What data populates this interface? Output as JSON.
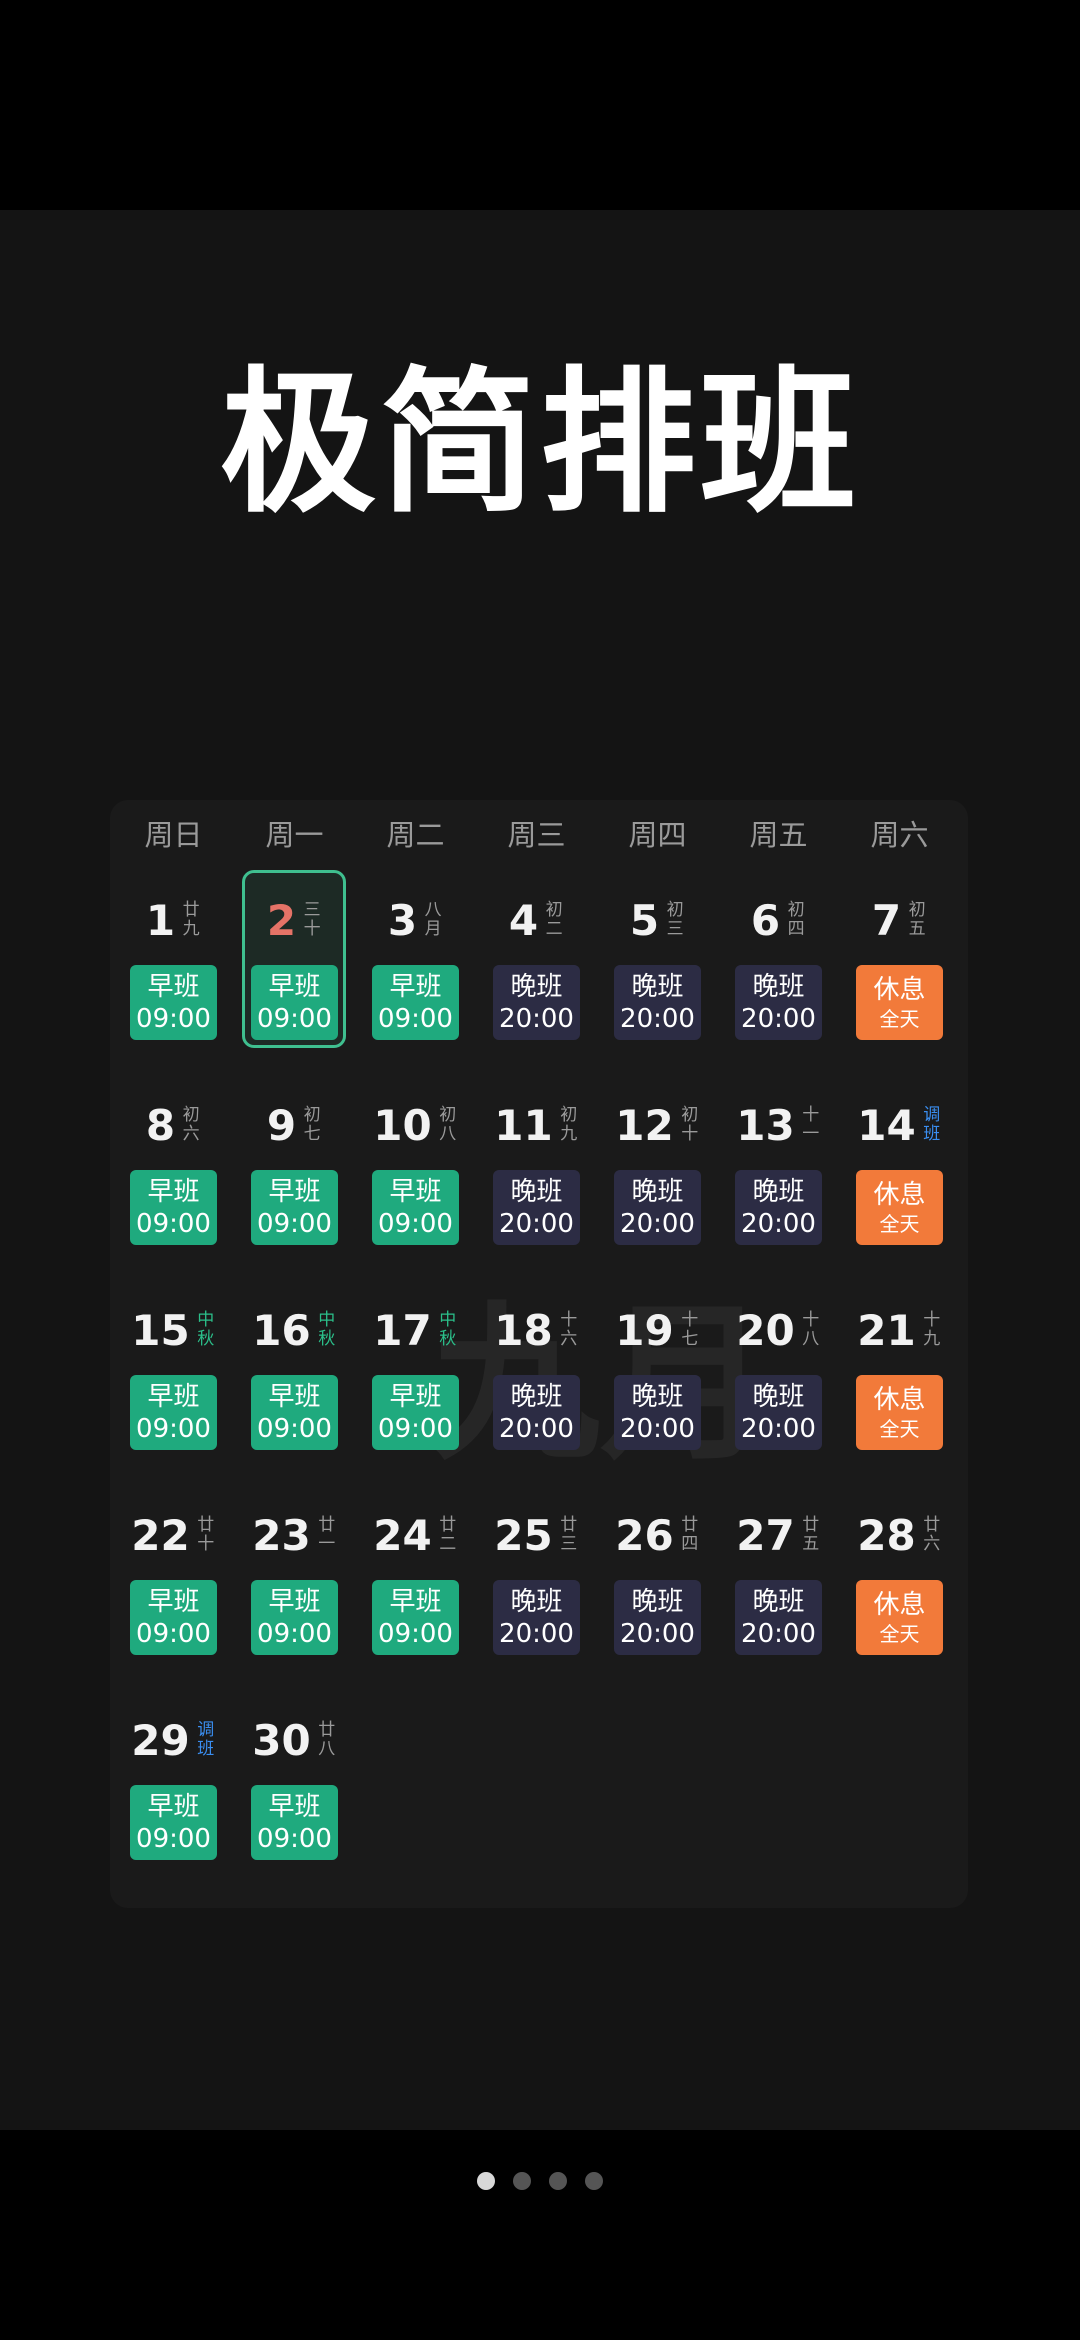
{
  "title": "极简排班",
  "watermark": "九月",
  "weekdays": [
    "周日",
    "周一",
    "周二",
    "周三",
    "周四",
    "周五",
    "周六"
  ],
  "selected_day": 2,
  "days": [
    {
      "n": "1",
      "lunar": [
        "廿",
        "九"
      ],
      "shift": "morning"
    },
    {
      "n": "2",
      "lunar": [
        "三",
        "十"
      ],
      "shift": "morning",
      "red": true
    },
    {
      "n": "3",
      "lunar": [
        "八",
        "月"
      ],
      "shift": "morning"
    },
    {
      "n": "4",
      "lunar": [
        "初",
        "二"
      ],
      "shift": "night"
    },
    {
      "n": "5",
      "lunar": [
        "初",
        "三"
      ],
      "shift": "night"
    },
    {
      "n": "6",
      "lunar": [
        "初",
        "四"
      ],
      "shift": "night"
    },
    {
      "n": "7",
      "lunar": [
        "初",
        "五"
      ],
      "shift": "rest"
    },
    {
      "n": "8",
      "lunar": [
        "初",
        "六"
      ],
      "shift": "morning"
    },
    {
      "n": "9",
      "lunar": [
        "初",
        "七"
      ],
      "shift": "morning"
    },
    {
      "n": "10",
      "lunar": [
        "初",
        "八"
      ],
      "shift": "morning"
    },
    {
      "n": "11",
      "lunar": [
        "初",
        "九"
      ],
      "shift": "night"
    },
    {
      "n": "12",
      "lunar": [
        "初",
        "十"
      ],
      "shift": "night"
    },
    {
      "n": "13",
      "lunar": [
        "十",
        "一"
      ],
      "shift": "night"
    },
    {
      "n": "14",
      "lunar": [
        "调",
        "班"
      ],
      "lunar_style": "adjust",
      "shift": "rest"
    },
    {
      "n": "15",
      "lunar": [
        "中",
        "秋"
      ],
      "lunar_style": "holiday",
      "shift": "morning"
    },
    {
      "n": "16",
      "lunar": [
        "中",
        "秋"
      ],
      "lunar_style": "holiday",
      "shift": "morning"
    },
    {
      "n": "17",
      "lunar": [
        "中",
        "秋"
      ],
      "lunar_style": "holiday",
      "shift": "morning"
    },
    {
      "n": "18",
      "lunar": [
        "十",
        "六"
      ],
      "shift": "night"
    },
    {
      "n": "19",
      "lunar": [
        "十",
        "七"
      ],
      "shift": "night"
    },
    {
      "n": "20",
      "lunar": [
        "十",
        "八"
      ],
      "shift": "night"
    },
    {
      "n": "21",
      "lunar": [
        "十",
        "九"
      ],
      "shift": "rest"
    },
    {
      "n": "22",
      "lunar": [
        "廿",
        "十"
      ],
      "shift": "morning"
    },
    {
      "n": "23",
      "lunar": [
        "廿",
        "一"
      ],
      "shift": "morning"
    },
    {
      "n": "24",
      "lunar": [
        "廿",
        "二"
      ],
      "shift": "morning"
    },
    {
      "n": "25",
      "lunar": [
        "廿",
        "三"
      ],
      "shift": "night"
    },
    {
      "n": "26",
      "lunar": [
        "廿",
        "四"
      ],
      "shift": "night"
    },
    {
      "n": "27",
      "lunar": [
        "廿",
        "五"
      ],
      "shift": "night"
    },
    {
      "n": "28",
      "lunar": [
        "廿",
        "六"
      ],
      "shift": "rest"
    },
    {
      "n": "29",
      "lunar": [
        "调",
        "班"
      ],
      "lunar_style": "adjust",
      "shift": "morning"
    },
    {
      "n": "30",
      "lunar": [
        "廿",
        "八"
      ],
      "shift": "morning"
    }
  ],
  "shifts": {
    "morning": {
      "name": "早班",
      "time": "09:00",
      "color": "#1faa7e"
    },
    "night": {
      "name": "晚班",
      "time": "20:00",
      "color": "#2c2c44"
    },
    "rest": {
      "name": "休息",
      "time": "全天",
      "color": "#f27a3a"
    }
  },
  "pager": {
    "count": 4,
    "active": 0
  }
}
